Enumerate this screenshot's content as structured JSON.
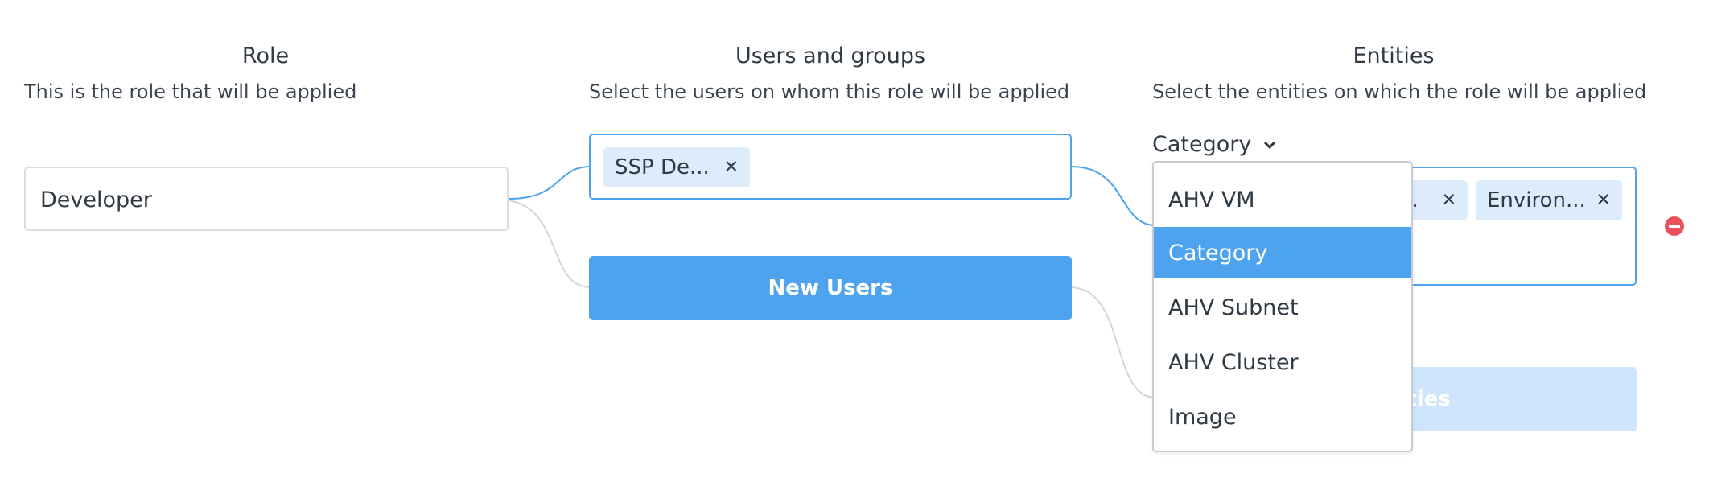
{
  "colors": {
    "accent": "#4da3ee",
    "chip_bg": "#dcecfb",
    "remove": "#e8505b",
    "connector": "#4da3ee",
    "connector_inactive": "#d3d7db"
  },
  "role": {
    "title": "Role",
    "description": "This is the role that will be applied",
    "value": "Developer"
  },
  "users": {
    "title": "Users and groups",
    "description": "Select the users on whom this role will be applied",
    "chips": [
      {
        "label": "SSP De..."
      }
    ],
    "new_button_label": "New Users"
  },
  "entities": {
    "title": "Entities",
    "description": "Select the entities on which the role will be applied",
    "type_selector": {
      "label": "Category",
      "icon": "chevron-down-icon"
    },
    "chips": [
      {
        "label": "..."
      },
      {
        "label": "Environ..."
      }
    ],
    "add_button_partial_label": "tities",
    "remove_icon": "remove-circle-icon"
  },
  "dropdown": {
    "options": [
      {
        "label": "AHV VM",
        "selected": false
      },
      {
        "label": "Category",
        "selected": true
      },
      {
        "label": "AHV Subnet",
        "selected": false
      },
      {
        "label": "AHV Cluster",
        "selected": false
      },
      {
        "label": "Image",
        "selected": false
      }
    ]
  }
}
